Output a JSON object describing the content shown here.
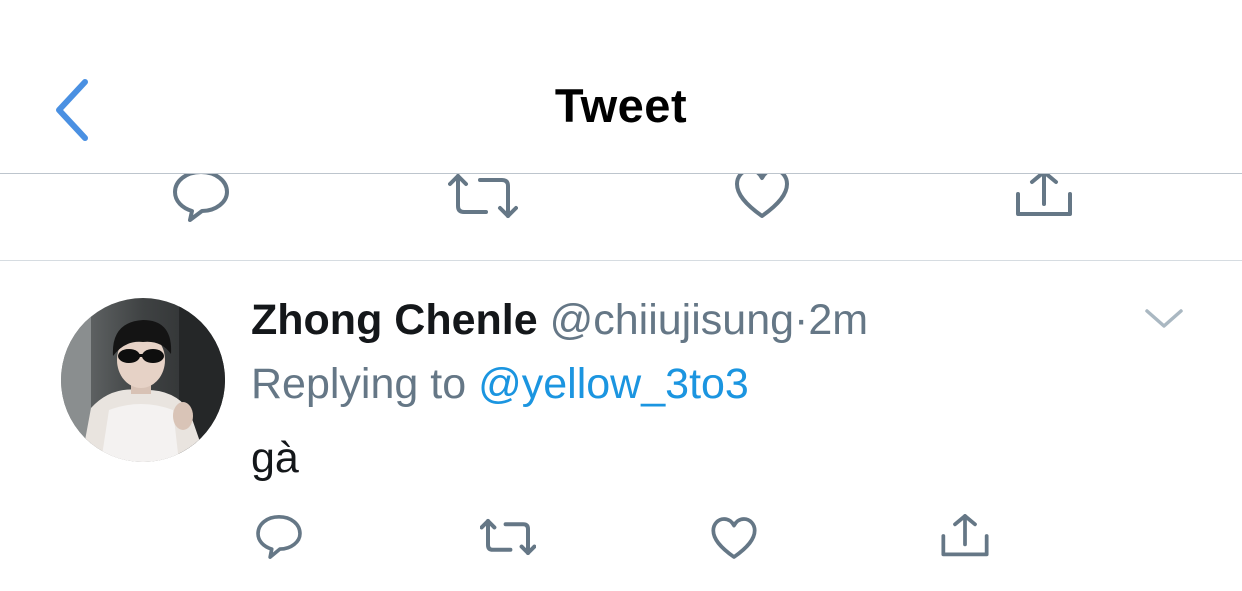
{
  "header": {
    "title": "Tweet",
    "back_icon": "chevron-left-icon"
  },
  "colors": {
    "accent": "#1b95e0",
    "back": "#4a90e2",
    "muted": "#657786",
    "icon": "#657786",
    "divider": "#d6dce1"
  },
  "top_actions": {
    "icons": [
      "reply-icon",
      "retweet-icon",
      "like-icon",
      "share-icon"
    ]
  },
  "reply_tweet": {
    "display_name": "Zhong Chenle",
    "handle": "@chiiujisung",
    "separator": "·",
    "time": "2m",
    "replying_prefix": "Replying to",
    "replying_to": "@yellow_3to3",
    "text": "gà",
    "actions": [
      "reply-icon",
      "retweet-icon",
      "like-icon",
      "share-icon"
    ]
  }
}
